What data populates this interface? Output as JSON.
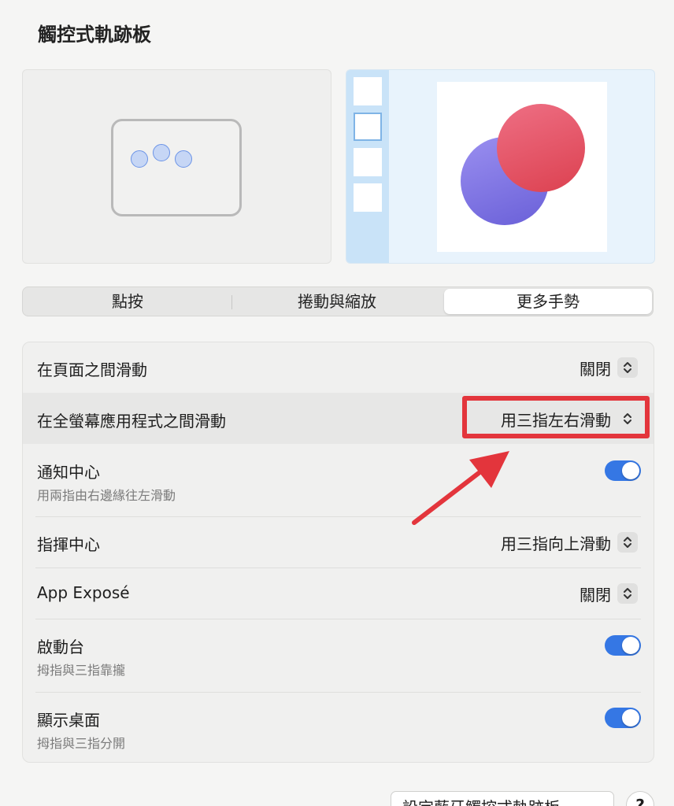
{
  "header": {
    "title": "觸控式軌跡板"
  },
  "tabs": [
    {
      "label": "點按",
      "selected": false
    },
    {
      "label": "捲動與縮放",
      "selected": false
    },
    {
      "label": "更多手勢",
      "selected": true
    }
  ],
  "settings": {
    "swipe_pages": {
      "label": "在頁面之間滑動",
      "value": "關閉"
    },
    "swipe_fullscreen": {
      "label": "在全螢幕應用程式之間滑動",
      "value": "用三指左右滑動"
    },
    "notification_center": {
      "label": "通知中心",
      "sub": "用兩指由右邊緣往左滑動",
      "enabled": true
    },
    "mission_control": {
      "label": "指揮中心",
      "value": "用三指向上滑動"
    },
    "app_expose": {
      "label": "App Exposé",
      "value": "關閉"
    },
    "launchpad": {
      "label": "啟動台",
      "sub": "拇指與三指靠攏",
      "enabled": true
    },
    "show_desktop": {
      "label": "顯示桌面",
      "sub": "拇指與三指分開",
      "enabled": true
    }
  },
  "footer": {
    "bluetooth_button": "設定藍牙觸控式軌跡板⋯",
    "help": "?"
  },
  "colors": {
    "accent": "#3577e4",
    "annotation": "#e3353c"
  }
}
